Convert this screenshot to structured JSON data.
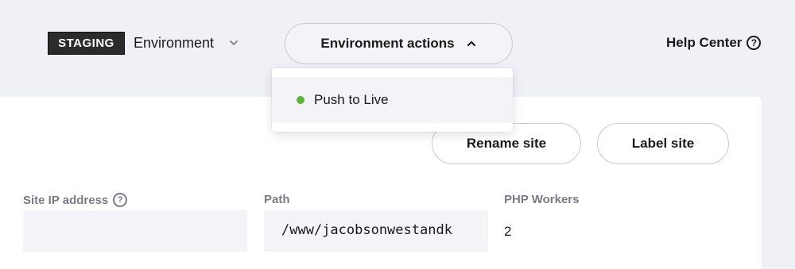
{
  "topbar": {
    "env_badge": "STAGING",
    "env_label": "Environment",
    "env_actions_label": "Environment actions",
    "help_label": "Help Center"
  },
  "dropdown": {
    "items": [
      {
        "label": "Push to Live",
        "status_color": "#5bb33a"
      }
    ]
  },
  "actions": {
    "rename_label": "Rename site",
    "label_label": "Label site"
  },
  "fields": {
    "ip": {
      "label": "Site IP address",
      "value": ""
    },
    "path": {
      "label": "Path",
      "value": "/www/jacobsonwestandk"
    },
    "php": {
      "label": "PHP Workers",
      "value": "2"
    }
  },
  "icons": {
    "env_chevron": "chevron-down-icon",
    "actions_chevron": "chevron-up-icon",
    "help": "question-circle-icon",
    "ip_help": "question-circle-icon"
  }
}
